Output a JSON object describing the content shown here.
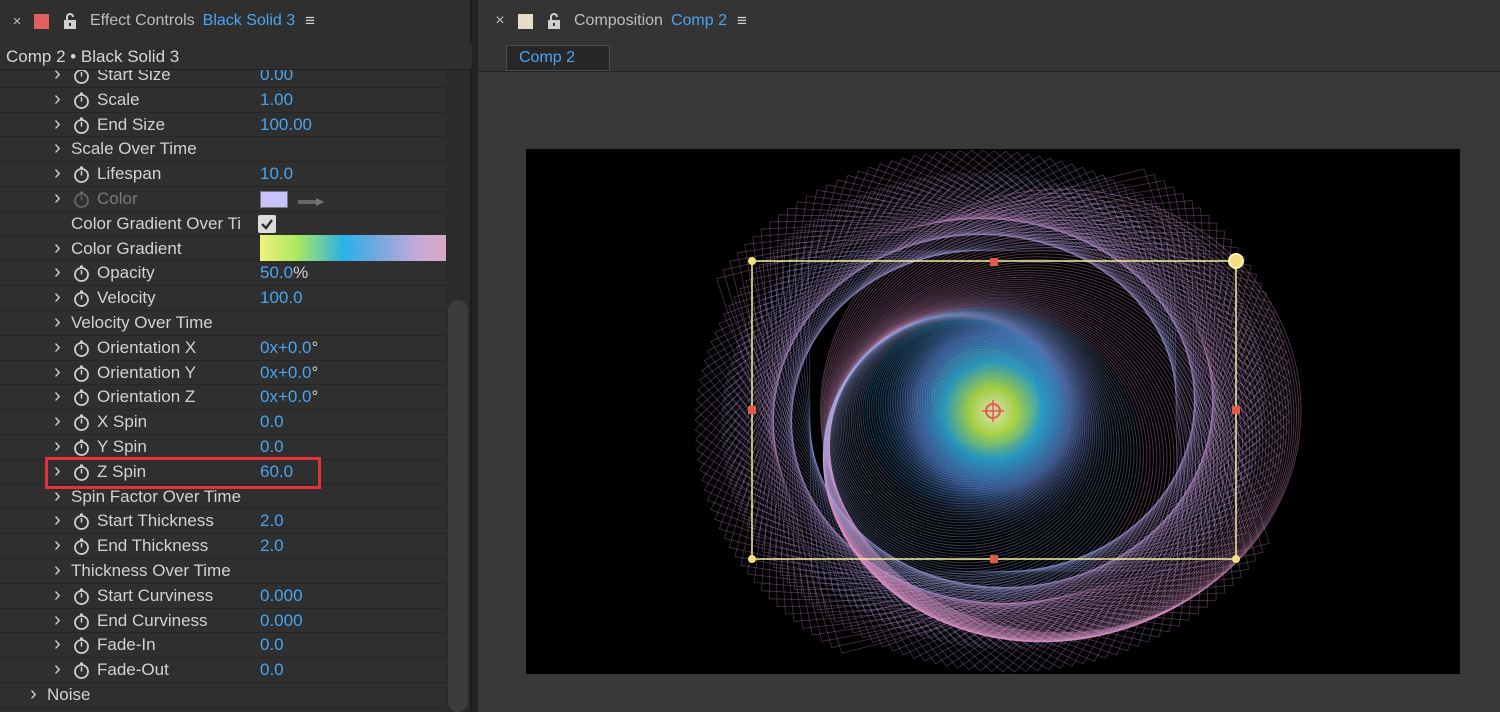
{
  "left_panel": {
    "close_glyph": "×",
    "title": "Effect Controls",
    "layer_name": "Black Solid 3",
    "menu_glyph": "≡",
    "swatch_color": "#e06060",
    "subheader": "Comp 2 • Black Solid 3"
  },
  "properties": [
    {
      "name": "Start Size",
      "value": "0.00",
      "stopwatch": true
    },
    {
      "name": "Scale",
      "value": "1.00",
      "stopwatch": true
    },
    {
      "name": "End Size",
      "value": "100.00",
      "stopwatch": true
    },
    {
      "name": "Scale Over Time",
      "value": "",
      "stopwatch": false
    },
    {
      "name": "Lifespan",
      "value": "10.0",
      "stopwatch": true
    },
    {
      "name": "Color",
      "value": "",
      "stopwatch": true,
      "dim": true,
      "color_swatch": "#c8c2ff"
    },
    {
      "name": "Color Gradient Over Ti",
      "value": "",
      "stopwatch": false,
      "checkbox": true,
      "no_chevron": true
    },
    {
      "name": "Color Gradient",
      "value": "",
      "stopwatch": false,
      "gradient": true
    },
    {
      "name": "Opacity",
      "value": "50.0",
      "unit": "%",
      "stopwatch": true
    },
    {
      "name": "Velocity",
      "value": "100.0",
      "stopwatch": true
    },
    {
      "name": "Velocity Over Time",
      "value": "",
      "stopwatch": false
    },
    {
      "name": "Orientation X",
      "value": "0x+0.0",
      "unit": "°",
      "stopwatch": true
    },
    {
      "name": "Orientation Y",
      "value": "0x+0.0",
      "unit": "°",
      "stopwatch": true
    },
    {
      "name": "Orientation Z",
      "value": "0x+0.0",
      "unit": "°",
      "stopwatch": true
    },
    {
      "name": "X Spin",
      "value": "0.0",
      "stopwatch": true
    },
    {
      "name": "Y Spin",
      "value": "0.0",
      "stopwatch": true
    },
    {
      "name": "Z Spin",
      "value": "60.0",
      "stopwatch": true
    },
    {
      "name": "Spin Factor Over Time",
      "value": "",
      "stopwatch": false
    },
    {
      "name": "Start Thickness",
      "value": "2.0",
      "stopwatch": true
    },
    {
      "name": "End Thickness",
      "value": "2.0",
      "stopwatch": true
    },
    {
      "name": "Thickness Over Time",
      "value": "",
      "stopwatch": false
    },
    {
      "name": "Start Curviness",
      "value": "0.000",
      "stopwatch": true
    },
    {
      "name": "End Curviness",
      "value": "0.000",
      "stopwatch": true
    },
    {
      "name": "Fade-In",
      "value": "0.0",
      "stopwatch": true
    },
    {
      "name": "Fade-Out",
      "value": "0.0",
      "stopwatch": true
    },
    {
      "name": "Noise",
      "value": "",
      "stopwatch": false,
      "top_level": true
    }
  ],
  "right_panel": {
    "close_glyph": "×",
    "title": "Composition",
    "comp_name": "Comp 2",
    "menu_glyph": "≡",
    "swatch_color": "#e8dcc8",
    "tab_label": "Comp 2"
  },
  "colors": {
    "accent_blue": "#4aa4f0",
    "highlight_red": "#e8303a",
    "bounding_box": "#f4f09a"
  }
}
